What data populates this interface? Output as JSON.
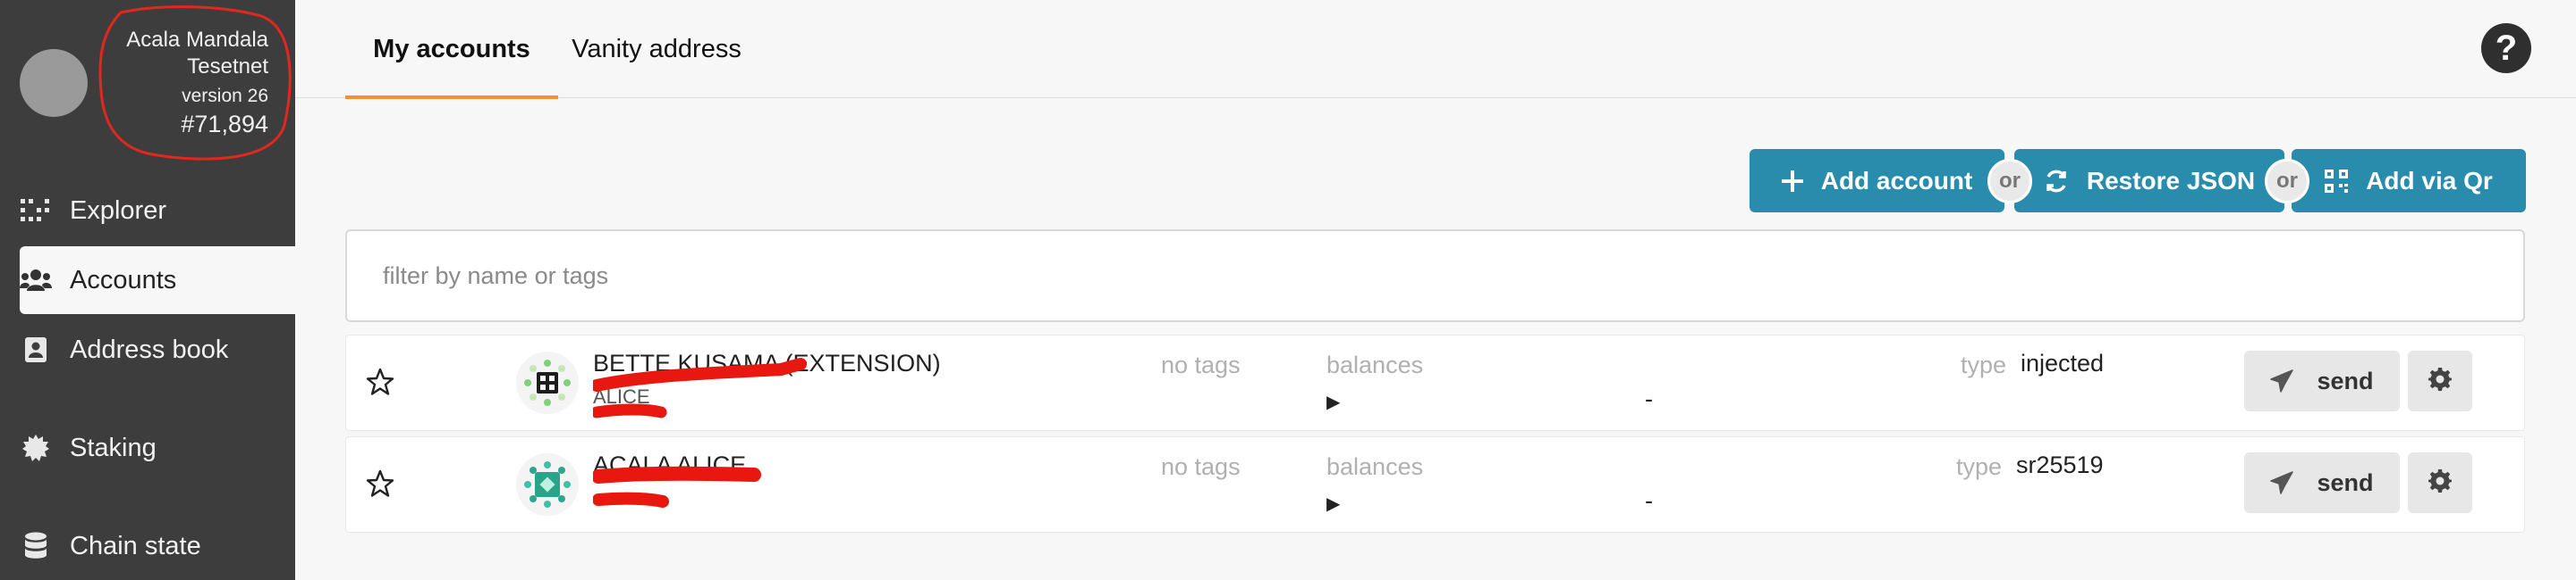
{
  "chain": {
    "name_line1": "Acala Mandala",
    "name_line2": "Tesetnet",
    "version": "version 26",
    "block": "#71,894"
  },
  "sidebar": {
    "items": [
      {
        "label": "Explorer",
        "icon": "explorer-icon",
        "active": false
      },
      {
        "label": "Accounts",
        "icon": "users-icon",
        "active": true
      },
      {
        "label": "Address book",
        "icon": "address-book-icon",
        "active": false
      },
      {
        "label": "Staking",
        "icon": "staking-icon",
        "active": false
      },
      {
        "label": "Chain state",
        "icon": "database-icon",
        "active": false
      }
    ]
  },
  "header": {
    "tabs": [
      {
        "label": "My accounts",
        "active": true
      },
      {
        "label": "Vanity address",
        "active": false
      }
    ],
    "help_icon": "question-circle-icon",
    "help_label": "?"
  },
  "actions": {
    "add_account": "Add account",
    "restore_json": "Restore JSON",
    "add_via_qr": "Add via Qr",
    "or_label": "or"
  },
  "filter": {
    "placeholder": "filter by name or tags",
    "value": ""
  },
  "accounts": [
    {
      "name": "BETTE KUSAMA (EXTENSION)",
      "sub": "ALICE",
      "tags": "no tags",
      "balances_label": "balances",
      "balance": "-",
      "type_label": "type",
      "type": "injected",
      "send_label": "send"
    },
    {
      "name": "ACALA ALICE",
      "sub": "",
      "tags": "no tags",
      "balances_label": "balances",
      "balance": "-",
      "type_label": "type",
      "type": "sr25519",
      "send_label": "send"
    }
  ],
  "colors": {
    "sidebar_bg": "#3d3d3d",
    "accent_orange": "#f19135",
    "button_blue": "#2a8cad",
    "annotation_red": "#e0281e"
  }
}
